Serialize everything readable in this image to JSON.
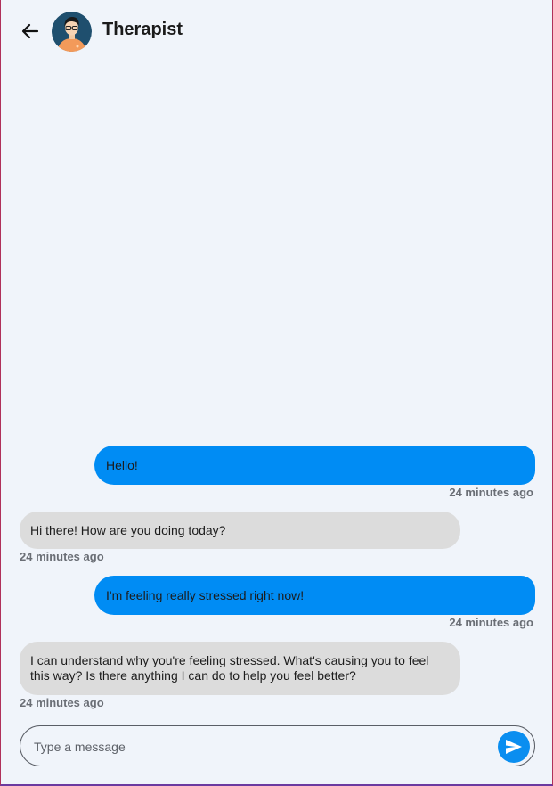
{
  "header": {
    "title": "Therapist",
    "back_icon": "arrow-left-icon",
    "avatar_icon": "therapist-avatar"
  },
  "colors": {
    "outgoing_bubble": "#008cf4",
    "incoming_bubble": "#dcdcdc",
    "background": "#f0f4fa",
    "send_button": "#0a8ef0"
  },
  "messages": [
    {
      "from": "user",
      "text": "Hello!",
      "time": "24 minutes ago"
    },
    {
      "from": "therapist",
      "text": "Hi there! How are you doing today?",
      "time": "24 minutes ago"
    },
    {
      "from": "user",
      "text": "I'm feeling really stressed right now!",
      "time": "24 minutes ago"
    },
    {
      "from": "therapist",
      "text": "I can understand why you're feeling stressed. What's causing you to feel this way? Is there anything I can do to help you feel better?",
      "time": "24 minutes ago"
    }
  ],
  "composer": {
    "placeholder": "Type a message",
    "value": "",
    "send_icon": "send-icon"
  }
}
